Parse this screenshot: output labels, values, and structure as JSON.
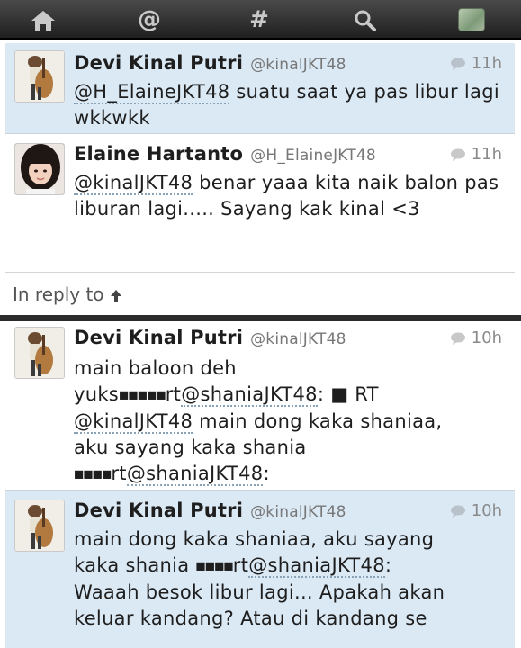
{
  "navbar": {
    "icons": [
      "home-icon",
      "at-mentions-icon",
      "hashtag-icon",
      "search-icon",
      "profile-icon"
    ],
    "at_symbol": "@",
    "hash_symbol": "#"
  },
  "top_panel": {
    "tweets": [
      {
        "name": "Devi Kinal Putri",
        "handle": "@kinalJKT48",
        "time": "11h",
        "mention": "@H_ElaineJKT48",
        "text_after_mention": " suatu saat ya pas libur lagi wkkwkk",
        "highlight": true
      },
      {
        "name": "Elaine Hartanto",
        "handle": "@H_ElaineJKT48",
        "time": "11h",
        "mention": "@kinalJKT48",
        "text_after_mention": " benar yaaa kita naik balon pas liburan lagi..... Sayang kak kinal <3",
        "highlight": false
      }
    ],
    "reply_label": "In reply to"
  },
  "bottom_panel": {
    "tweets": [
      {
        "name": "Devi Kinal Putri",
        "handle": "@kinalJKT48",
        "time": "10h",
        "line1": "main baloon deh",
        "line2_pre": "yuks",
        "line2_marks": "■■■■■",
        "line2_rt": "rt",
        "line2_mention": "@shaniaJKT48",
        "line2_post": ": ■ RT",
        "line3_mention": "@kinalJKT48",
        "line3_post": " main dong kaka shaniaa,",
        "line4": "aku sayang kaka shania",
        "line5_marks": "■■■■",
        "line5_rt": "rt",
        "line5_mention": "@shaniaJKT48",
        "line5_post": ":",
        "highlight": false
      },
      {
        "name": "Devi Kinal Putri",
        "handle": "@kinalJKT48",
        "time": "10h",
        "line1": "main dong kaka shaniaa, aku sayang",
        "line2_pre": "kaka shania ",
        "line2_marks": "■■■■",
        "line2_rt": "rt",
        "line2_mention": "@shaniaJKT48",
        "line2_post": ":",
        "line3": "Waaah besok libur lagi... Apakah akan",
        "line4": "keluar kandang? Atau di kandang se",
        "highlight": true
      }
    ]
  },
  "colors": {
    "highlight_bg": "#dbe9f5",
    "navbar_bg": "#2a2a2a",
    "name_text": "#1e1e1e",
    "meta_text": "#8a8a8a"
  }
}
